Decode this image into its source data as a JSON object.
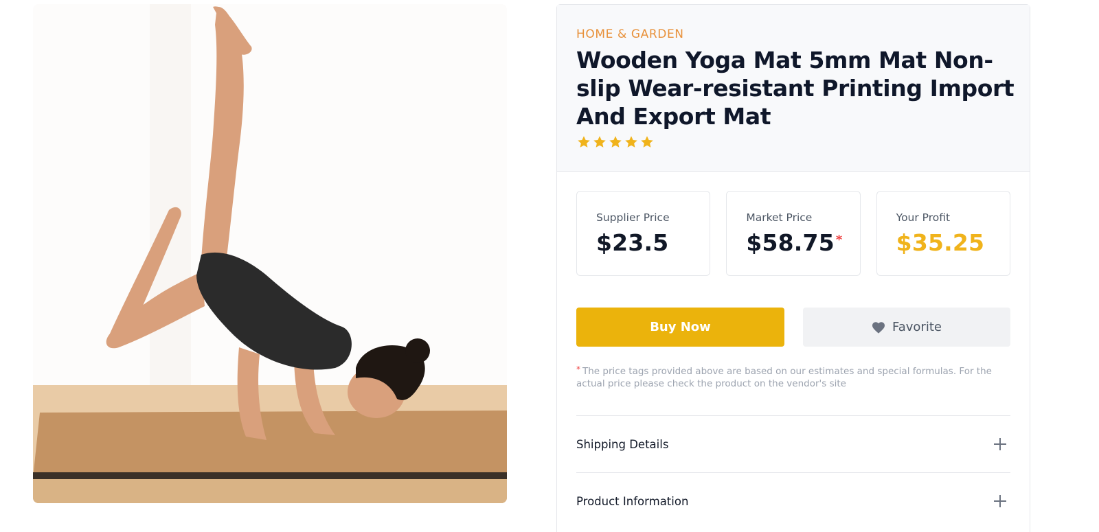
{
  "product": {
    "category": "HOME & GARDEN",
    "title": "Wooden Yoga Mat 5mm Mat Non-slip Wear-resistant Printing Import And Export Mat",
    "rating": 5,
    "rating_max": 5,
    "image_icon": "yoga-photo"
  },
  "prices": {
    "supplier": {
      "label": "Supplier Price",
      "value": "$23.5"
    },
    "market": {
      "label": "Market Price",
      "value": "$58.75",
      "asterisk": "*"
    },
    "profit": {
      "label": "Your Profit",
      "value": "$35.25"
    }
  },
  "actions": {
    "buy_label": "Buy Now",
    "favorite_label": "Favorite",
    "favorite_icon": "heart-icon"
  },
  "disclaimer": {
    "asterisk": "*",
    "text": "The price tags provided above are based on our estimates and special formulas. For the actual price please check the product on the vendor's site"
  },
  "accordion": [
    {
      "label": "Shipping Details",
      "icon": "plus-icon"
    },
    {
      "label": "Product Information",
      "icon": "plus-icon"
    }
  ],
  "colors": {
    "accent": "#ebb30c",
    "category": "#e8913a",
    "profit": "#f0b31b",
    "star": "#f0b31b",
    "asterisk": "#ef4444"
  }
}
